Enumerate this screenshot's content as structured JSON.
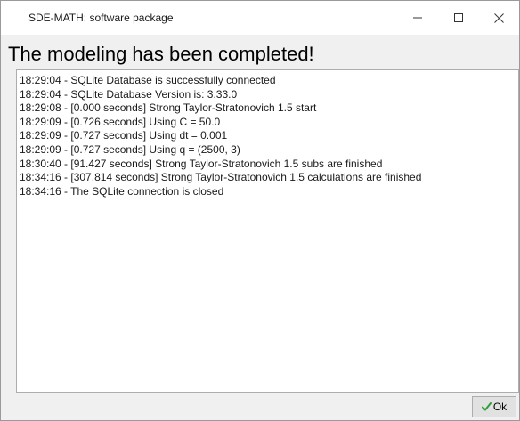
{
  "window": {
    "title": "SDE-MATH: software package",
    "controls": {
      "minimize_icon": "minimize-icon",
      "maximize_icon": "maximize-icon",
      "close_icon": "close-icon"
    }
  },
  "heading": "The modeling has been completed!",
  "log": {
    "lines": [
      "18:29:04 - SQLite Database is successfully connected",
      "18:29:04 - SQLite Database Version is: 3.33.0",
      "18:29:08 - [0.000 seconds] Strong Taylor-Stratonovich 1.5 start",
      "18:29:09 - [0.726 seconds] Using C = 50.0",
      "18:29:09 - [0.727 seconds] Using dt = 0.001",
      "18:29:09 - [0.727 seconds] Using q = (2500, 3)",
      "18:30:40 - [91.427 seconds] Strong Taylor-Stratonovich 1.5 subs are finished",
      "18:34:16 - [307.814 seconds] Strong Taylor-Stratonovich 1.5 calculations are finished",
      "18:34:16 - The SQLite connection is closed"
    ]
  },
  "ok_button": {
    "label": "Ok",
    "icon": "checkmark-icon",
    "check_color": "#2e9e3a"
  }
}
